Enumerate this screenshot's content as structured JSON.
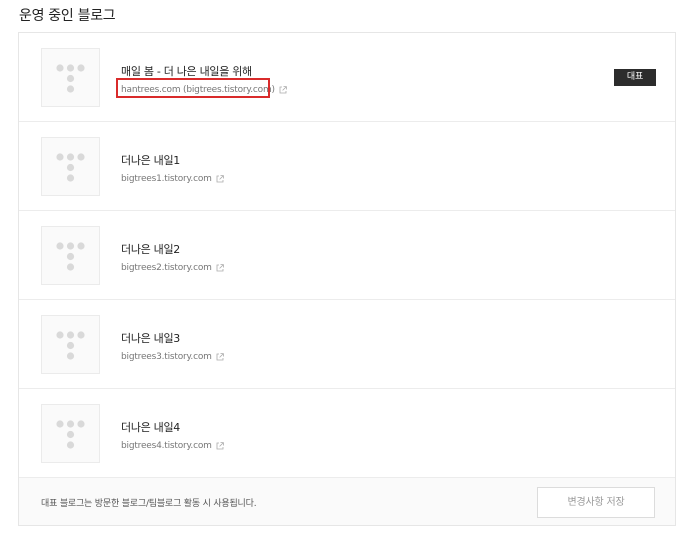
{
  "section": {
    "title": "운영 중인 블로그"
  },
  "blogs": [
    {
      "name": "매일 봄 - 더 나은 내일을 위해",
      "url": "hantrees.com (bigtrees.tistory.com)",
      "is_representative": true,
      "badge_label": "대표",
      "highlighted": true
    },
    {
      "name": "더나은 내일1",
      "url": "bigtrees1.tistory.com",
      "is_representative": false
    },
    {
      "name": "더나은 내일2",
      "url": "bigtrees2.tistory.com",
      "is_representative": false
    },
    {
      "name": "더나은 내일3",
      "url": "bigtrees3.tistory.com",
      "is_representative": false
    },
    {
      "name": "더나은 내일4",
      "url": "bigtrees4.tistory.com",
      "is_representative": false
    }
  ],
  "footer": {
    "note": "대표 블로그는 방문한 블로그/팀블로그 활동 시 사용됩니다.",
    "save_label": "변경사항 저장"
  },
  "colors": {
    "badge_bg": "#2c2c2c",
    "highlight_border": "#d92b2b",
    "thumb_dot": "#d9d9d9"
  },
  "icons": {
    "thumbnail": "tistory-logo-icon",
    "external_link": "external-link-icon"
  }
}
